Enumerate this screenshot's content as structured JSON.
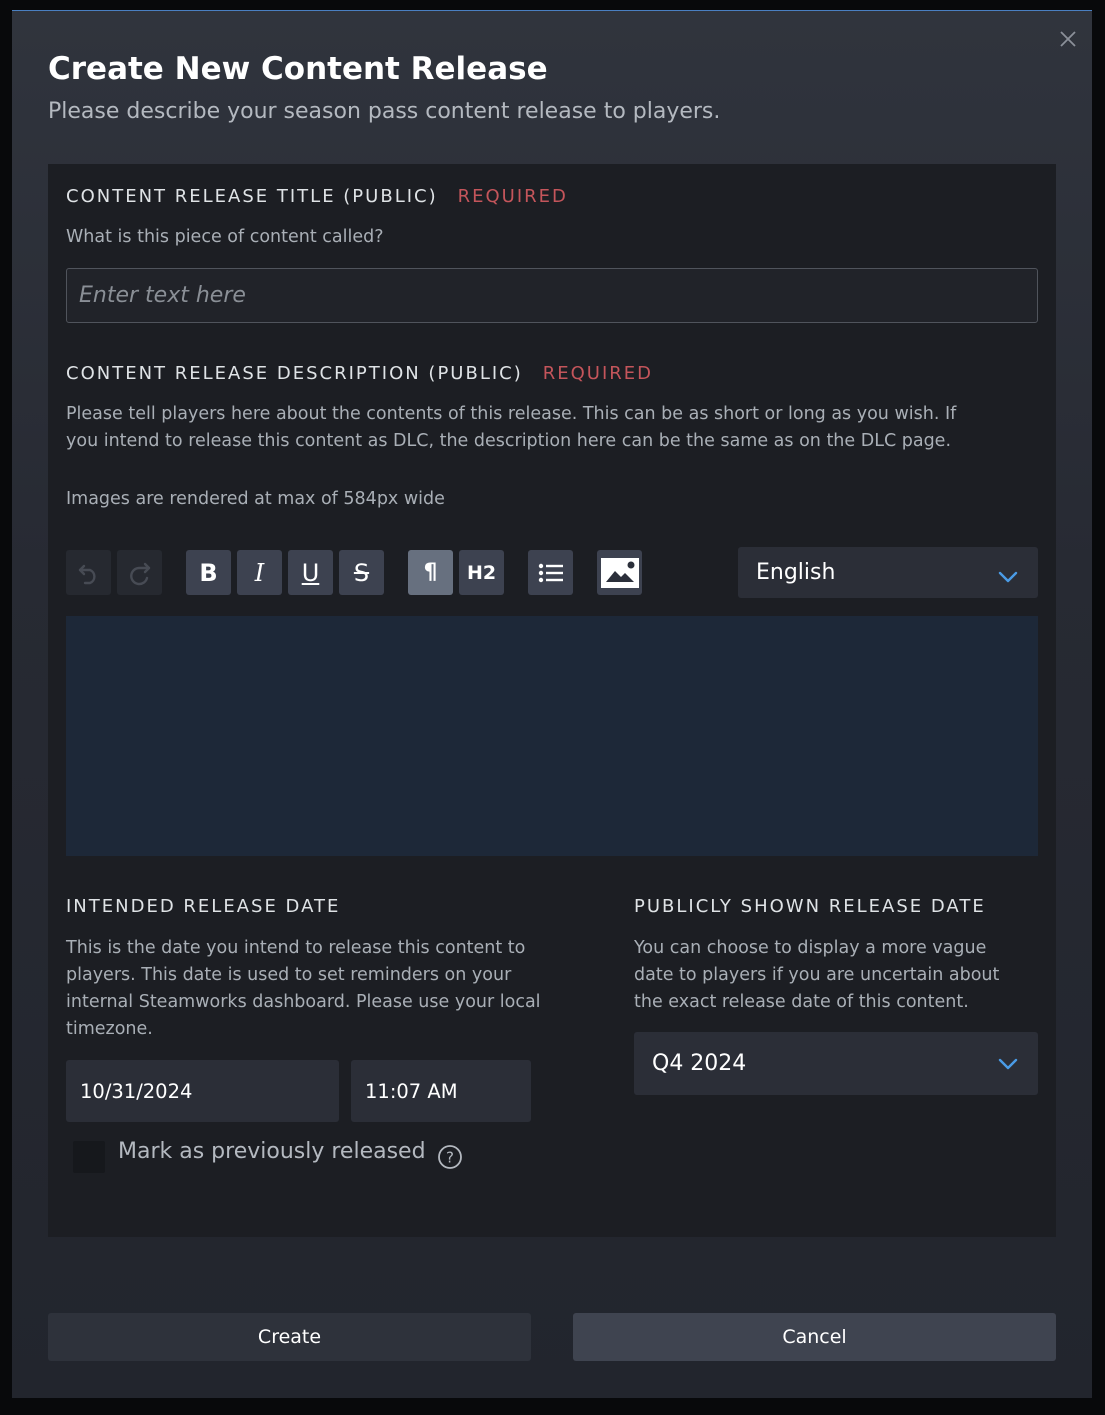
{
  "dialog": {
    "title": "Create New Content Release",
    "subtitle": "Please describe your season pass content release to players.",
    "close_icon": "close-icon"
  },
  "title_field": {
    "label": "CONTENT RELEASE TITLE (PUBLIC)",
    "required": "REQUIRED",
    "help": "What is this piece of content called?",
    "value": "",
    "placeholder": "Enter text here"
  },
  "description_field": {
    "label": "CONTENT RELEASE DESCRIPTION (PUBLIC)",
    "required": "REQUIRED",
    "help_line1": "Please tell players here about the contents of this release. This can be as short or long as you wish. If",
    "help_line2": "you intend to release this content as DLC, the description here can be the same as on the DLC page.",
    "image_note": "Images are rendered at max of 584px wide",
    "editor_value": "",
    "toolbar": [
      {
        "name": "undo",
        "icon": "undo-icon",
        "enabled": false
      },
      {
        "name": "redo",
        "icon": "redo-icon",
        "enabled": false
      },
      {
        "name": "bold",
        "glyph": "B"
      },
      {
        "name": "italic",
        "glyph": "I"
      },
      {
        "name": "underline",
        "glyph": "U"
      },
      {
        "name": "strikethrough",
        "glyph": "S"
      },
      {
        "name": "paragraph",
        "glyph": "¶",
        "active": true
      },
      {
        "name": "heading2",
        "glyph": "H2"
      },
      {
        "name": "bullet-list",
        "icon": "list-icon"
      },
      {
        "name": "insert-image",
        "icon": "image-icon"
      }
    ],
    "language": {
      "selected": "English"
    }
  },
  "intended_release": {
    "label": "INTENDED RELEASE DATE",
    "help": "This is the date you intend to release this content to players. This date is used to set reminders on your internal Steamworks dashboard. Please use your local timezone.",
    "date": "10/31/2024",
    "time": "11:07 AM",
    "previously_released": {
      "label": "Mark as previously released",
      "checked": false
    }
  },
  "public_release": {
    "label": "PUBLICLY SHOWN RELEASE DATE",
    "help": "You can choose to display a more vague date to players if you are uncertain about the exact release date of this content.",
    "selected": "Q4 2024"
  },
  "footer": {
    "create_label": "Create",
    "cancel_label": "Cancel"
  },
  "colors": {
    "accent_blue": "#4a90d9",
    "required_red": "#c4555b",
    "panel_bg": "#1c1e23",
    "editor_bg": "#1d2838"
  }
}
